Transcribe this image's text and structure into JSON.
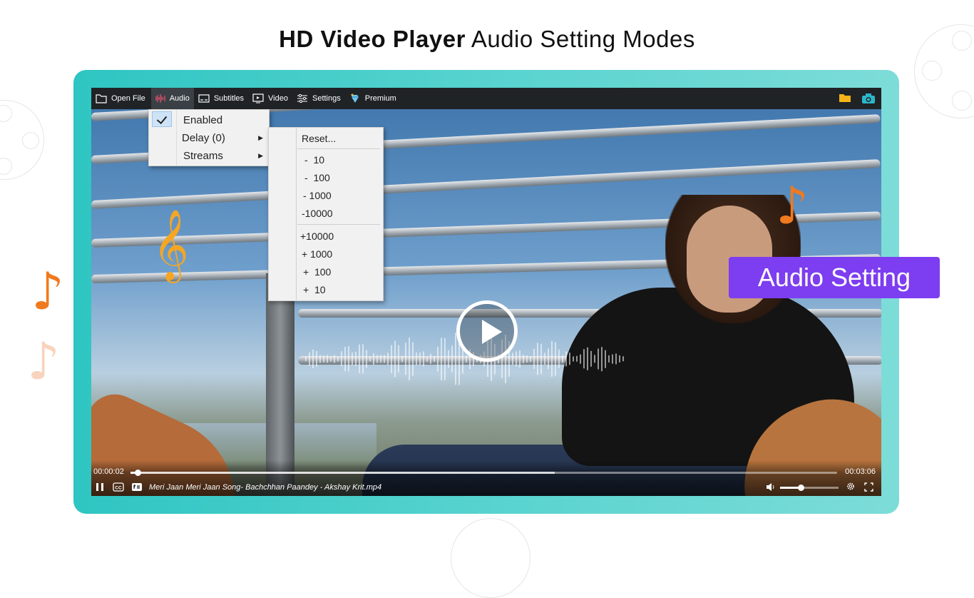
{
  "headline": {
    "bold": "HD Video Player",
    "light": "Audio Setting Modes"
  },
  "menubar": {
    "items": [
      {
        "label": "Open File",
        "icon": "folder-outline-icon"
      },
      {
        "label": "Audio",
        "icon": "audio-wave-icon",
        "active": true
      },
      {
        "label": "Subtitles",
        "icon": "subtitles-icon"
      },
      {
        "label": "Video",
        "icon": "video-icon"
      },
      {
        "label": "Settings",
        "icon": "sliders-icon"
      },
      {
        "label": "Premium",
        "icon": "diamond-icon"
      }
    ],
    "right_icons": [
      "folder-icon",
      "camera-icon"
    ]
  },
  "audio_menu": {
    "items": [
      {
        "label": "Enabled",
        "checked": true
      },
      {
        "label": "Delay (0)",
        "submenu": true
      },
      {
        "label": "Streams",
        "submenu": true
      }
    ]
  },
  "delay_submenu": {
    "items": [
      "Reset...",
      "-  10",
      "-  100",
      "- 1000",
      "-10000",
      "+10000",
      "+ 1000",
      "+  100",
      "+  10"
    ]
  },
  "controls": {
    "current_time": "00:00:02",
    "total_time": "00:03:06",
    "progress": 0.01,
    "buffered": 0.6,
    "filename": "Meri Jaan Meri Jaan Song- Bachchhan Paandey - Akshay Krit.mp4",
    "volume": 0.35
  },
  "badge": {
    "label": "Audio Setting"
  },
  "colors": {
    "accent_frame": "#2ec5c2",
    "badge": "#7d3df0",
    "note_orange": "#f07a1f"
  }
}
